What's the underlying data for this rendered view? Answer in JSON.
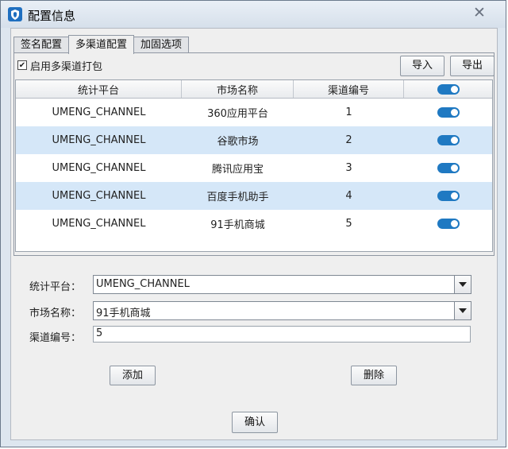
{
  "window": {
    "title": "配置信息",
    "close_glyph": "✕"
  },
  "tabs": [
    {
      "label": "签名配置"
    },
    {
      "label": "多渠道配置"
    },
    {
      "label": "加固选项"
    }
  ],
  "panel": {
    "enable_checkbox": {
      "label": "启用多渠道打包",
      "checked": true,
      "glyph": "✔"
    },
    "import_label": "导入",
    "export_label": "导出"
  },
  "table": {
    "headers": [
      "统计平台",
      "市场名称",
      "渠道编号"
    ],
    "rows": [
      {
        "platform": "UMENG_CHANNEL",
        "market": "360应用平台",
        "channel": "1",
        "enabled": true
      },
      {
        "platform": "UMENG_CHANNEL",
        "market": "谷歌市场",
        "channel": "2",
        "enabled": true
      },
      {
        "platform": "UMENG_CHANNEL",
        "market": "腾讯应用宝",
        "channel": "3",
        "enabled": true
      },
      {
        "platform": "UMENG_CHANNEL",
        "market": "百度手机助手",
        "channel": "4",
        "enabled": true
      },
      {
        "platform": "UMENG_CHANNEL",
        "market": "91手机商城",
        "channel": "5",
        "enabled": true
      }
    ]
  },
  "form": {
    "platform_label": "统计平台：",
    "platform_value": "UMENG_CHANNEL",
    "market_label": "市场名称：",
    "market_value": "91手机商城",
    "channel_label": "渠道编号：",
    "channel_value": "5"
  },
  "buttons": {
    "add": "添加",
    "delete": "删除",
    "ok": "确认"
  },
  "colors": {
    "accent": "#1f79c2",
    "selected_row": "#d5e7f8"
  }
}
